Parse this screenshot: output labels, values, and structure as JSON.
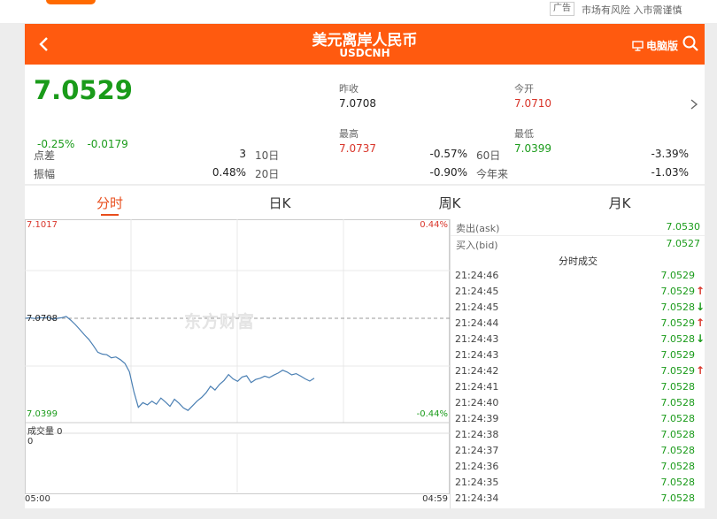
{
  "top": {
    "ad_label": "广告",
    "risk_text": "市场有风险 入市需谨慎"
  },
  "header": {
    "title": "美元离岸人民币",
    "code": "USDCNH",
    "pc_label": "电脑版",
    "bg_color": "#ff5a0f"
  },
  "quote": {
    "price": "7.0529",
    "change_pct": "-0.25%",
    "change": "-0.0179",
    "prev_close_label": "昨收",
    "prev_close": "7.0708",
    "open_label": "今开",
    "open": "7.0710",
    "high_label": "最高",
    "high": "7.0737",
    "low_label": "最低",
    "low": "7.0399",
    "stats": {
      "points_label": "点差",
      "points": "3",
      "d10_label": "10日",
      "d10": "-0.57%",
      "d60_label": "60日",
      "d60": "-3.39%",
      "amp_label": "振幅",
      "amp": "0.48%",
      "d20_label": "20日",
      "d20": "-0.90%",
      "ytd_label": "今年来",
      "ytd": "-1.03%"
    }
  },
  "tabs": [
    "分时",
    "日K",
    "周K",
    "月K"
  ],
  "chart": {
    "y_top": "7.1017",
    "y_mid": "7.0708",
    "y_bottom": "7.0399",
    "pct_top": "0.44%",
    "pct_bottom": "-0.44%",
    "watermark": "东方财富",
    "volume_label": "成交量 0",
    "volume_axis": "0",
    "time_start": "05:00",
    "time_end": "04:59",
    "grid_color": "#e8e8e8",
    "line_color": "#4a7fb3"
  },
  "chart_data": {
    "type": "line",
    "title": "",
    "xlabel": "",
    "ylabel": "",
    "ylim": [
      7.0399,
      7.1017
    ],
    "baseline": 7.0708,
    "x_range": [
      "05:00",
      "04:59"
    ],
    "series": [
      {
        "values": [
          7.0708,
          7.071,
          7.0707,
          7.0711,
          7.0709,
          7.0712,
          7.0705,
          7.0708,
          7.071,
          7.0714,
          7.0702,
          7.0688,
          7.0672,
          7.0655,
          7.064,
          7.062,
          7.0598,
          7.0592,
          7.059,
          7.058,
          7.0583,
          7.0574,
          7.0562,
          7.0535,
          7.047,
          7.042,
          7.0435,
          7.0428,
          7.044,
          7.043,
          7.045,
          7.0437,
          7.0423,
          7.0446,
          7.0433,
          7.0418,
          7.041,
          7.0425,
          7.044,
          7.0452,
          7.0467,
          7.0488,
          7.0476,
          7.0494,
          7.0507,
          7.0526,
          7.0512,
          7.0504,
          7.0518,
          7.0522,
          7.05,
          7.051,
          7.0514,
          7.0521,
          7.0516,
          7.0524,
          7.0531,
          7.054,
          7.0534,
          7.0525,
          7.0529,
          7.0521,
          7.0512,
          7.0505,
          7.0514
        ]
      }
    ]
  },
  "trade": {
    "ask_label": "卖出(ask)",
    "ask": "7.0530",
    "bid_label": "买入(bid)",
    "bid": "7.0527",
    "ticks_title": "分时成交",
    "ticks": [
      {
        "time": "21:24:46",
        "price": "7.0529",
        "dir": ""
      },
      {
        "time": "21:24:45",
        "price": "7.0529",
        "dir": "up"
      },
      {
        "time": "21:24:45",
        "price": "7.0528",
        "dir": "down"
      },
      {
        "time": "21:24:44",
        "price": "7.0529",
        "dir": "up"
      },
      {
        "time": "21:24:43",
        "price": "7.0528",
        "dir": "down"
      },
      {
        "time": "21:24:43",
        "price": "7.0529",
        "dir": ""
      },
      {
        "time": "21:24:42",
        "price": "7.0529",
        "dir": "up"
      },
      {
        "time": "21:24:41",
        "price": "7.0528",
        "dir": ""
      },
      {
        "time": "21:24:40",
        "price": "7.0528",
        "dir": ""
      },
      {
        "time": "21:24:39",
        "price": "7.0528",
        "dir": ""
      },
      {
        "time": "21:24:38",
        "price": "7.0528",
        "dir": ""
      },
      {
        "time": "21:24:37",
        "price": "7.0528",
        "dir": ""
      },
      {
        "time": "21:24:36",
        "price": "7.0528",
        "dir": ""
      },
      {
        "time": "21:24:35",
        "price": "7.0528",
        "dir": ""
      },
      {
        "time": "21:24:34",
        "price": "7.0528",
        "dir": ""
      }
    ]
  }
}
